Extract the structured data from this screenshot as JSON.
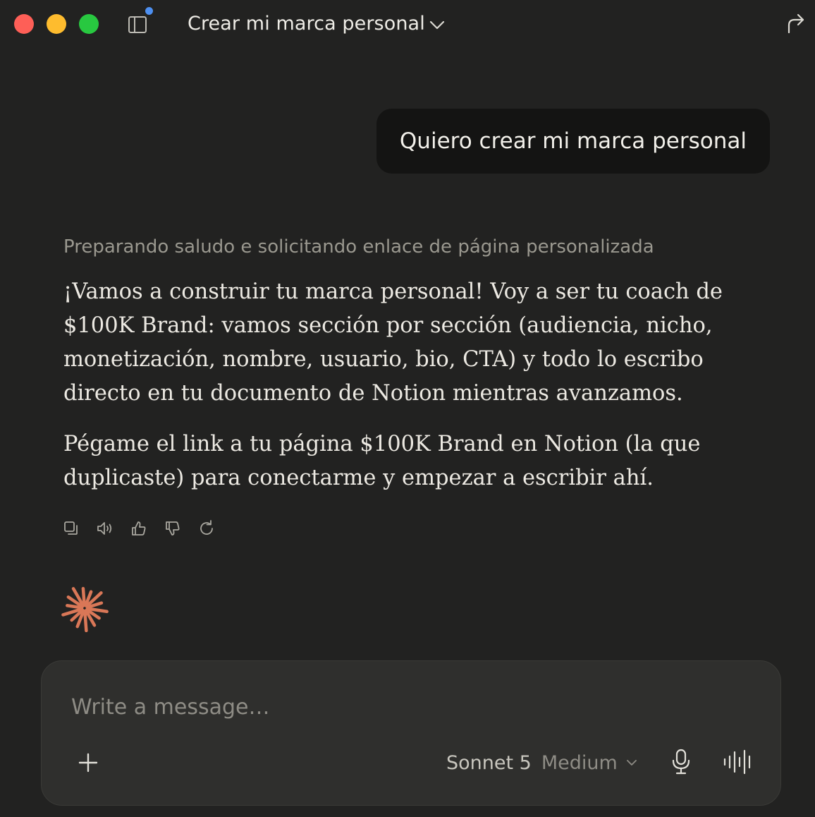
{
  "window": {
    "title": "Crear mi marca personal"
  },
  "conversation": {
    "user_message": "Quiero crear mi marca personal",
    "thinking_summary": "Preparando saludo e solicitando enlace de página personalizada",
    "assistant_paragraphs": {
      "p1_lines": [
        "¡Vamos a construir tu marca personal! Voy a ser tu coach de",
        "$100K Brand: vamos sección por sección (audiencia, nicho,",
        "monetización, nombre, usuario, bio, CTA) y todo lo escribo",
        "directo en tu documento de Notion mientras avanzamos."
      ],
      "p2_lines": [
        "Pégame el link a tu página $100K Brand en Notion (la que",
        "duplicaste) para conectarme y empezar a escribir ahí."
      ]
    },
    "message_actions": [
      "copy-icon",
      "speaker-icon",
      "thumbs-up-icon",
      "thumbs-down-icon",
      "retry-icon"
    ]
  },
  "composer": {
    "placeholder": "Write a message…",
    "value": "",
    "model": "Sonnet 5",
    "effort": "Medium"
  },
  "colors": {
    "background": "#222221",
    "bubble": "#141413",
    "composer": "#2f2f2d",
    "accent_spark": "#d97757",
    "sidebar_dot": "#4d8ff0"
  }
}
